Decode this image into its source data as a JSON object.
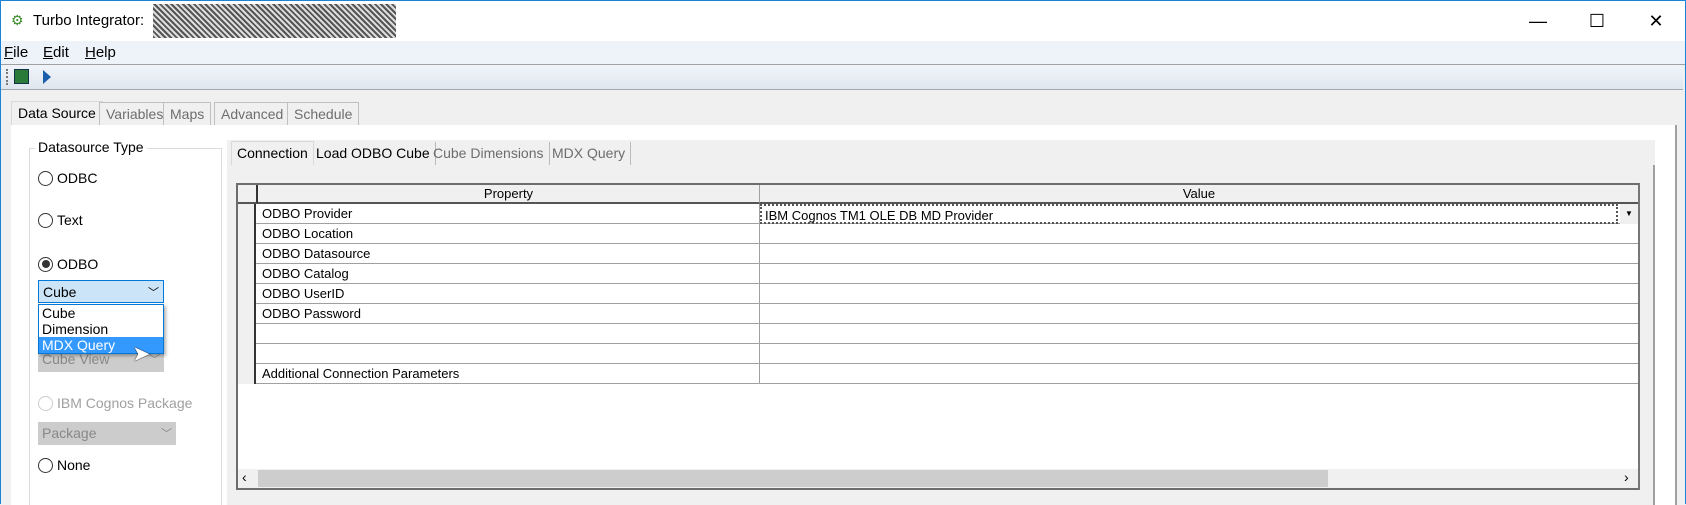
{
  "window": {
    "title": "Turbo Integrator:",
    "minimize": "—",
    "maximize": "☐",
    "close": "✕"
  },
  "menu": [
    {
      "label": "File",
      "u": "F",
      "rest": "ile"
    },
    {
      "label": "Edit",
      "u": "E",
      "rest": "dit"
    },
    {
      "label": "Help",
      "u": "H",
      "rest": "elp"
    }
  ],
  "toolbar": {
    "icons": [
      "save-icon",
      "run-icon"
    ]
  },
  "tabs": [
    "Data Source",
    "Variables",
    "Maps",
    "Advanced",
    "Schedule"
  ],
  "datasource": {
    "group_label": "Datasource Type",
    "options": [
      "ODBC",
      "Text",
      "ODBO",
      "IBM Cognos Package",
      "None"
    ],
    "selected": "ODBO",
    "odbo_combo": "Cube",
    "odbo_list": [
      "Cube",
      "Dimension",
      "MDX Query"
    ],
    "highlighted": "MDX Query",
    "cube_view": "Cube View",
    "package": "Package"
  },
  "inner_tabs": [
    "Connection",
    "Load ODBO Cube",
    "Cube Dimensions",
    "MDX Query"
  ],
  "grid": {
    "headers": [
      "Property",
      "Value"
    ],
    "rows": [
      {
        "property": "ODBO Provider",
        "value": "IBM Cognos TM1 OLE DB MD Provider"
      },
      {
        "property": "ODBO Location",
        "value": ""
      },
      {
        "property": "ODBO Datasource",
        "value": ""
      },
      {
        "property": "ODBO Catalog",
        "value": ""
      },
      {
        "property": "ODBO UserID",
        "value": ""
      },
      {
        "property": "ODBO Password",
        "value": ""
      },
      {
        "property": "",
        "value": ""
      },
      {
        "property": "",
        "value": ""
      },
      {
        "property": "Additional Connection Parameters",
        "value": ""
      }
    ]
  }
}
